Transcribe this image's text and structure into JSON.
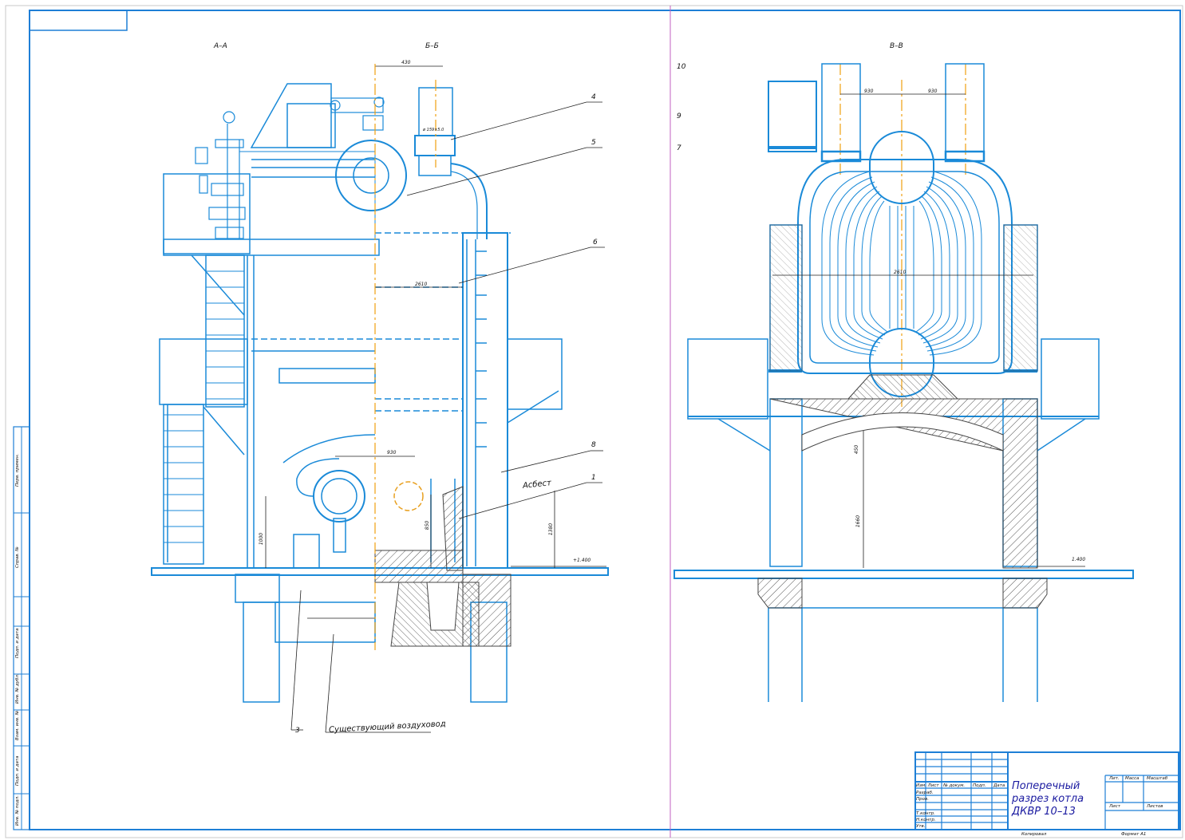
{
  "sections": {
    "a_a": "А–А",
    "b_b": "Б–Б",
    "v_v": "В–В"
  },
  "callouts": {
    "c1": "1",
    "c3": "3",
    "c4": "4",
    "c5": "5",
    "c6": "6",
    "c7": "7",
    "c8": "8",
    "c9": "9",
    "c10": "10",
    "asbest": "Асбест",
    "duct": "Существующий воздуховод"
  },
  "dimensions": {
    "d430": "430",
    "d2610": "2610",
    "d2610b": "2610",
    "d930a": "930",
    "d850": "850",
    "d1380": "1380",
    "d1660": "1660",
    "d450": "450",
    "d1000": "1000",
    "elev_left": "+1.400",
    "elev_right": "1.400",
    "d930b": "930",
    "d930c": "930",
    "d_pipe": "ø 159×5.0"
  },
  "title_block": {
    "title": "Поперечный разрез котла ДКВР 10–13",
    "rows": [
      "Изм. Лист",
      "Разраб.",
      "Пров.",
      "Т.контр.",
      "Н.контр.",
      "Утв."
    ],
    "col_headers": [
      "№ докум.",
      "Подп.",
      "Дата"
    ],
    "lit": "Лит.",
    "mass": "Масса",
    "scale": "Масштаб",
    "sheet": "Лист",
    "sheets": "Листов",
    "copied": "Копировал",
    "format": "Формат  А1"
  },
  "side_strip": [
    "Перв. примен.",
    "Справ. №",
    "Подп. и дата",
    "Инв. № дубл.",
    "Взам. инв. №",
    "Подп. и дата",
    "Инв. № подл."
  ],
  "colors": {
    "frame": "#1e7fd6",
    "drawing": "#1a8ad8",
    "hatch": "#4a4a4a",
    "axis": "#f0a010",
    "sheet_divider": "#c060c0"
  }
}
